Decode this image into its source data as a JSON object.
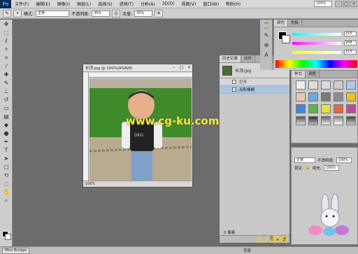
{
  "app": {
    "logo": "Ps"
  },
  "menu": {
    "items": [
      "文件(F)",
      "编辑(E)",
      "图像(I)",
      "图层(L)",
      "选择(S)",
      "滤镜(T)",
      "分析(A)",
      "3D(D)",
      "视图(V)",
      "窗口(W)",
      "帮助(H)"
    ],
    "zoom": "100%"
  },
  "options": {
    "feather_label": "模式:",
    "mode_value": "正常",
    "opacity_label": "不透明度:",
    "opacity_value": "35%",
    "flow_label": "流量:",
    "flow_value": "35%"
  },
  "document": {
    "title": "长顶.jpg @ 100%(RGB/8)",
    "status": "100%"
  },
  "history": {
    "tabs": [
      "历史记录",
      "动作"
    ],
    "snapshot_name": "长顶.jpg",
    "rows": [
      "打开",
      "高斯模糊"
    ]
  },
  "color": {
    "tabs": [
      "颜色",
      "色板"
    ],
    "values": [
      "215",
      "208",
      "215"
    ]
  },
  "styles": {
    "tabs": [
      "样式",
      "调整"
    ]
  },
  "adjust": {
    "mode_value": "正常",
    "opacity_label": "不透明度:",
    "opacity_value": "100%",
    "fill_label": "填充:",
    "fill_value": "100%",
    "lock_label": "锁定:"
  },
  "statusbar": {
    "tab_label": "Mini Bridge",
    "bottom_label": "0 像素",
    "layer_label": "背景"
  },
  "watermark": {
    "main": "www.cg-ku.com",
    "corner": "人人素材"
  }
}
